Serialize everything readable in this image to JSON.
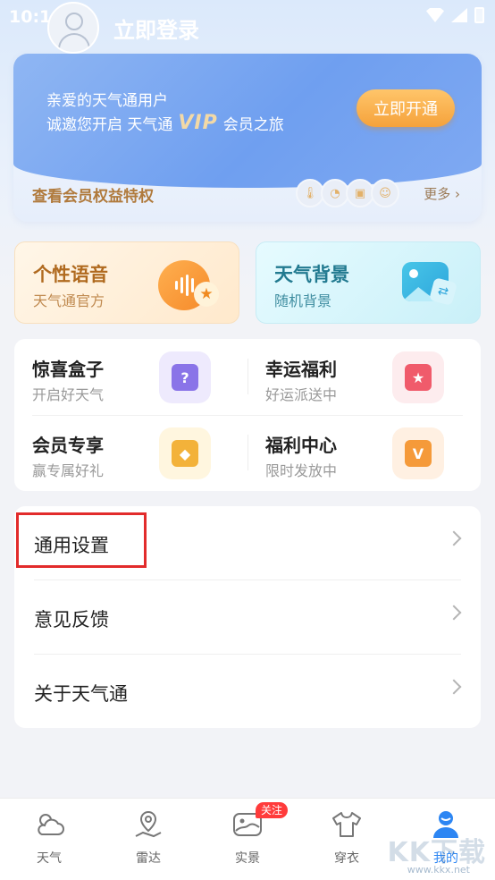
{
  "status_bar": {
    "time": "10:16"
  },
  "profile": {
    "login_label": "立即登录"
  },
  "vip": {
    "greeting": "亲爱的天气通用户",
    "invite_prefix": "诚邀您开启 天气通",
    "vip_logo": "VIP",
    "invite_suffix": "会员之旅",
    "cta": "立即开通",
    "benefits_label": "查看会员权益特权",
    "more_label": "更多",
    "benefit_icons": [
      "thermometer-icon",
      "gauge-icon",
      "ticket-icon",
      "smile-icon"
    ]
  },
  "features": [
    {
      "title": "个性语音",
      "subtitle": "天气通官方",
      "icon": "voice-star-icon"
    },
    {
      "title": "天气背景",
      "subtitle": "随机背景",
      "icon": "picture-icon"
    }
  ],
  "grid": [
    {
      "title": "惊喜盒子",
      "subtitle": "开启好天气",
      "icon": "mystery-box-icon",
      "color": "#8a74e8",
      "bg": "#eeeafd"
    },
    {
      "title": "幸运福利",
      "subtitle": "好运派送中",
      "icon": "star-badge-icon",
      "color": "#f05b6b",
      "bg": "#fdecee"
    },
    {
      "title": "会员专享",
      "subtitle": "赢专属好礼",
      "icon": "diamond-icon",
      "color": "#f3b23a",
      "bg": "#fff6df"
    },
    {
      "title": "福利中心",
      "subtitle": "限时发放中",
      "icon": "coupon-icon",
      "color": "#f59a3a",
      "bg": "#fff0e2"
    }
  ],
  "settings": [
    {
      "label": "通用设置"
    },
    {
      "label": "意见反馈"
    },
    {
      "label": "关于天气通"
    }
  ],
  "tabs": [
    {
      "label": "天气",
      "icon": "weather-icon"
    },
    {
      "label": "雷达",
      "icon": "radar-location-icon"
    },
    {
      "label": "实景",
      "icon": "photo-icon",
      "badge": "关注"
    },
    {
      "label": "穿衣",
      "icon": "tshirt-icon"
    },
    {
      "label": "我的",
      "icon": "user-icon",
      "active": true
    }
  ],
  "watermark": {
    "text": "KK下载",
    "url": "www.kkx.net"
  }
}
